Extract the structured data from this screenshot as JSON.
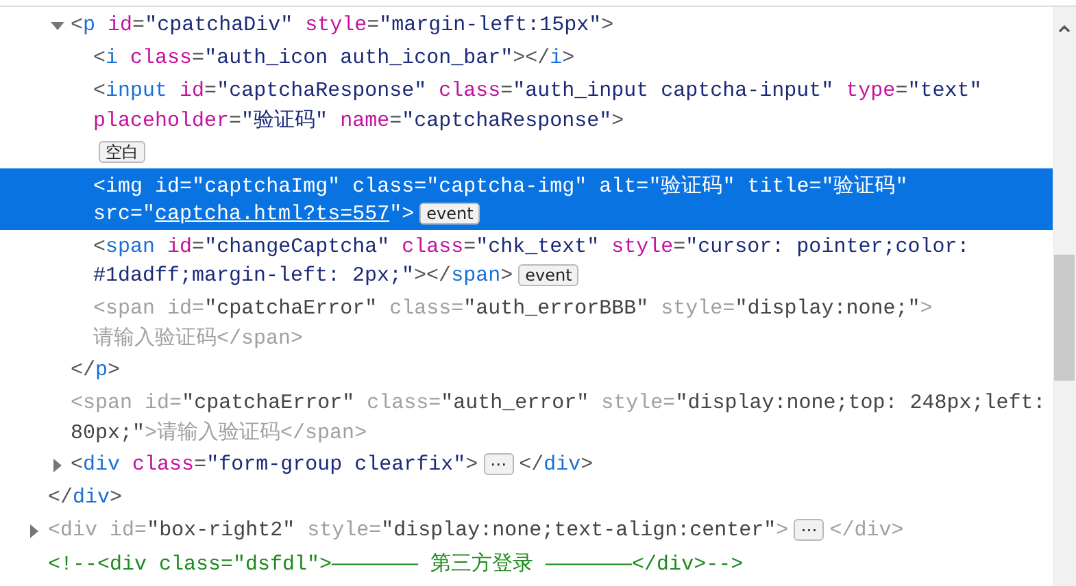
{
  "nodes": [
    {
      "children": [
        {
          "expanded": true,
          "selected": false,
          "dimmed": false,
          "lines": [
            [
              {
                "code": [
                  {
                    "kind": "punct",
                    "text": "<"
                  },
                  {
                    "kind": "tag",
                    "text": "p"
                  },
                  {
                    "kind": "attr",
                    "text": " id"
                  },
                  {
                    "kind": "punct",
                    "text": "="
                  },
                  {
                    "kind": "value",
                    "text": "\"cpatchaDiv\""
                  },
                  {
                    "kind": "attr",
                    "text": " style"
                  },
                  {
                    "kind": "punct",
                    "text": "="
                  },
                  {
                    "kind": "value",
                    "text": "\"margin-left:15px\""
                  },
                  {
                    "kind": "punct",
                    "text": ">"
                  }
                ]
              }
            ]
          ],
          "children": [
            {
              "selected": false,
              "dimmed": false,
              "lines": [
                [
                  {
                    "code": [
                      {
                        "kind": "punct",
                        "text": "<"
                      },
                      {
                        "kind": "tag",
                        "text": "i"
                      },
                      {
                        "kind": "attr",
                        "text": " class"
                      },
                      {
                        "kind": "punct",
                        "text": "="
                      },
                      {
                        "kind": "value",
                        "text": "\"auth_icon auth_icon_bar\""
                      },
                      {
                        "kind": "punct",
                        "text": "></"
                      },
                      {
                        "kind": "tag",
                        "text": "i"
                      },
                      {
                        "kind": "punct",
                        "text": ">"
                      }
                    ]
                  }
                ]
              ]
            },
            {
              "selected": false,
              "dimmed": false,
              "lines": [
                [
                  {
                    "code": [
                      {
                        "kind": "punct",
                        "text": "<"
                      },
                      {
                        "kind": "tag",
                        "text": "input"
                      },
                      {
                        "kind": "attr",
                        "text": " id"
                      },
                      {
                        "kind": "punct",
                        "text": "="
                      },
                      {
                        "kind": "value",
                        "text": "\"captchaResponse\""
                      },
                      {
                        "kind": "attr",
                        "text": " class"
                      },
                      {
                        "kind": "punct",
                        "text": "="
                      },
                      {
                        "kind": "value",
                        "text": "\"auth_input captcha-input\""
                      },
                      {
                        "kind": "attr",
                        "text": " type"
                      },
                      {
                        "kind": "punct",
                        "text": "="
                      },
                      {
                        "kind": "value",
                        "text": "\"text\""
                      }
                    ]
                  }
                ],
                [
                  {
                    "code": [
                      {
                        "kind": "attr",
                        "text": "placeholder"
                      },
                      {
                        "kind": "punct",
                        "text": "="
                      },
                      {
                        "kind": "value",
                        "text": "\"验证码\""
                      },
                      {
                        "kind": "attr",
                        "text": " name"
                      },
                      {
                        "kind": "punct",
                        "text": "="
                      },
                      {
                        "kind": "value",
                        "text": "\"captchaResponse\""
                      },
                      {
                        "kind": "punct",
                        "text": ">"
                      }
                    ]
                  }
                ]
              ]
            },
            {
              "selected": false,
              "lines": [
                [
                  {
                    "badge": "空白"
                  }
                ]
              ]
            },
            {
              "selected": true,
              "dimmed": false,
              "lines": [
                [
                  {
                    "code": [
                      {
                        "kind": "punct",
                        "text": "<"
                      },
                      {
                        "kind": "tag",
                        "text": "img"
                      },
                      {
                        "kind": "attr",
                        "text": " id"
                      },
                      {
                        "kind": "punct",
                        "text": "="
                      },
                      {
                        "kind": "value",
                        "text": "\"captchaImg\""
                      },
                      {
                        "kind": "attr",
                        "text": " class"
                      },
                      {
                        "kind": "punct",
                        "text": "="
                      },
                      {
                        "kind": "value",
                        "text": "\"captcha-img\""
                      },
                      {
                        "kind": "attr",
                        "text": " alt"
                      },
                      {
                        "kind": "punct",
                        "text": "="
                      },
                      {
                        "kind": "value",
                        "text": "\"验证码\""
                      },
                      {
                        "kind": "attr",
                        "text": " title"
                      },
                      {
                        "kind": "punct",
                        "text": "="
                      },
                      {
                        "kind": "value",
                        "text": "\"验证码\""
                      }
                    ]
                  }
                ],
                [
                  {
                    "code": [
                      {
                        "kind": "attr",
                        "text": "src"
                      },
                      {
                        "kind": "punct",
                        "text": "="
                      },
                      {
                        "kind": "value",
                        "text": "\""
                      },
                      {
                        "kind": "link",
                        "text": "captcha.html?ts=557"
                      },
                      {
                        "kind": "value",
                        "text": "\""
                      },
                      {
                        "kind": "punct",
                        "text": ">"
                      }
                    ]
                  },
                  {
                    "badge": "event"
                  }
                ]
              ]
            },
            {
              "selected": false,
              "dimmed": false,
              "lines": [
                [
                  {
                    "code": [
                      {
                        "kind": "punct",
                        "text": "<"
                      },
                      {
                        "kind": "tag",
                        "text": "span"
                      },
                      {
                        "kind": "attr",
                        "text": " id"
                      },
                      {
                        "kind": "punct",
                        "text": "="
                      },
                      {
                        "kind": "value",
                        "text": "\"changeCaptcha\""
                      },
                      {
                        "kind": "attr",
                        "text": " class"
                      },
                      {
                        "kind": "punct",
                        "text": "="
                      },
                      {
                        "kind": "value",
                        "text": "\"chk_text\""
                      },
                      {
                        "kind": "attr",
                        "text": " style"
                      },
                      {
                        "kind": "punct",
                        "text": "="
                      },
                      {
                        "kind": "value",
                        "text": "\"cursor: pointer;color:"
                      }
                    ]
                  }
                ],
                [
                  {
                    "code": [
                      {
                        "kind": "value",
                        "text": "#1dadff;margin-left: 2px;\""
                      },
                      {
                        "kind": "punct",
                        "text": "></"
                      },
                      {
                        "kind": "tag",
                        "text": "span"
                      },
                      {
                        "kind": "punct",
                        "text": ">"
                      }
                    ]
                  },
                  {
                    "badge": "event"
                  }
                ]
              ]
            },
            {
              "selected": false,
              "dimmed": true,
              "lines": [
                [
                  {
                    "code": [
                      {
                        "kind": "punct",
                        "text": "<"
                      },
                      {
                        "kind": "tag",
                        "text": "span"
                      },
                      {
                        "kind": "attr",
                        "text": " id"
                      },
                      {
                        "kind": "punct",
                        "text": "="
                      },
                      {
                        "kind": "value",
                        "text": "\"cpatchaError\""
                      },
                      {
                        "kind": "attr",
                        "text": " class"
                      },
                      {
                        "kind": "punct",
                        "text": "="
                      },
                      {
                        "kind": "value",
                        "text": "\"auth_errorBBB\""
                      },
                      {
                        "kind": "attr",
                        "text": " style"
                      },
                      {
                        "kind": "punct",
                        "text": "="
                      },
                      {
                        "kind": "value",
                        "text": "\"display:none;\""
                      },
                      {
                        "kind": "punct",
                        "text": ">"
                      }
                    ]
                  }
                ],
                [
                  {
                    "code": [
                      {
                        "kind": "text",
                        "text": "请输入验证码"
                      },
                      {
                        "kind": "punct",
                        "text": "</"
                      },
                      {
                        "kind": "tag",
                        "text": "span"
                      },
                      {
                        "kind": "punct",
                        "text": ">"
                      }
                    ]
                  }
                ]
              ]
            }
          ],
          "closing": [
            {
              "code": [
                {
                  "kind": "punct",
                  "text": "</"
                },
                {
                  "kind": "tag",
                  "text": "p"
                },
                {
                  "kind": "punct",
                  "text": ">"
                }
              ]
            }
          ]
        },
        {
          "selected": false,
          "dimmed": true,
          "lines": [
            [
              {
                "code": [
                  {
                    "kind": "punct",
                    "text": "<"
                  },
                  {
                    "kind": "tag",
                    "text": "span"
                  },
                  {
                    "kind": "attr",
                    "text": " id"
                  },
                  {
                    "kind": "punct",
                    "text": "="
                  },
                  {
                    "kind": "value",
                    "text": "\"cpatchaError\""
                  },
                  {
                    "kind": "attr",
                    "text": " class"
                  },
                  {
                    "kind": "punct",
                    "text": "="
                  },
                  {
                    "kind": "value",
                    "text": "\"auth_error\""
                  },
                  {
                    "kind": "attr",
                    "text": " style"
                  },
                  {
                    "kind": "punct",
                    "text": "="
                  },
                  {
                    "kind": "value",
                    "text": "\"display:none;top: 248px;left:"
                  }
                ]
              }
            ],
            [
              {
                "code": [
                  {
                    "kind": "value",
                    "text": "80px;\""
                  },
                  {
                    "kind": "punct",
                    "text": ">"
                  },
                  {
                    "kind": "text",
                    "text": "请输入验证码"
                  },
                  {
                    "kind": "punct",
                    "text": "</"
                  },
                  {
                    "kind": "tag",
                    "text": "span"
                  },
                  {
                    "kind": "punct",
                    "text": ">"
                  }
                ]
              }
            ]
          ]
        },
        {
          "expanded": false,
          "selected": false,
          "dimmed": false,
          "lines": [
            [
              {
                "code": [
                  {
                    "kind": "punct",
                    "text": "<"
                  },
                  {
                    "kind": "tag",
                    "text": "div"
                  },
                  {
                    "kind": "attr",
                    "text": " class"
                  },
                  {
                    "kind": "punct",
                    "text": "="
                  },
                  {
                    "kind": "value",
                    "text": "\"form-group clearfix\""
                  },
                  {
                    "kind": "punct",
                    "text": ">"
                  }
                ]
              },
              {
                "badge": "⋯"
              },
              {
                "code": [
                  {
                    "kind": "punct",
                    "text": "</"
                  },
                  {
                    "kind": "tag",
                    "text": "div"
                  },
                  {
                    "kind": "punct",
                    "text": ">"
                  }
                ]
              }
            ]
          ]
        }
      ],
      "closing": [
        {
          "code": [
            {
              "kind": "punct",
              "text": "</"
            },
            {
              "kind": "tag",
              "text": "div"
            },
            {
              "kind": "punct",
              "text": ">"
            }
          ]
        }
      ]
    },
    {
      "expanded": false,
      "selected": false,
      "dimmed": true,
      "lines": [
        [
          {
            "code": [
              {
                "kind": "punct",
                "text": "<"
              },
              {
                "kind": "tag",
                "text": "div"
              },
              {
                "kind": "attr",
                "text": " id"
              },
              {
                "kind": "punct",
                "text": "="
              },
              {
                "kind": "value",
                "text": "\"box-right2\""
              },
              {
                "kind": "attr",
                "text": " style"
              },
              {
                "kind": "punct",
                "text": "="
              },
              {
                "kind": "value",
                "text": "\"display:none;text-align:center\""
              },
              {
                "kind": "punct",
                "text": ">"
              }
            ]
          },
          {
            "badge": "⋯"
          },
          {
            "code": [
              {
                "kind": "punct",
                "text": "</"
              },
              {
                "kind": "tag",
                "text": "div"
              },
              {
                "kind": "punct",
                "text": ">"
              }
            ]
          }
        ]
      ]
    },
    {
      "selected": false,
      "lines": [
        [
          {
            "code": [
              {
                "kind": "comment",
                "text": "<!--<div class=\"dsfdl\">——————— 第三方登录 ———————</div>-->"
              }
            ]
          }
        ]
      ]
    }
  ]
}
